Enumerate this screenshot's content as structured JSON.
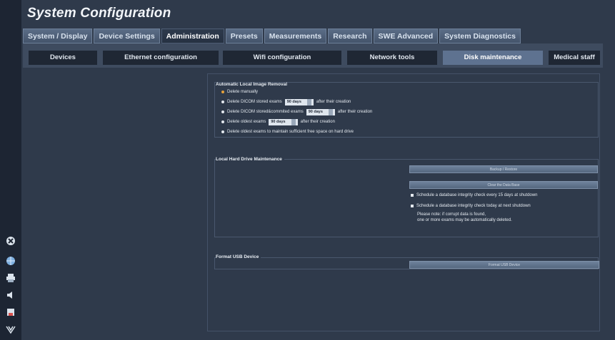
{
  "title": "System Configuration",
  "main_tabs": [
    {
      "label": "System / Display"
    },
    {
      "label": "Device Settings"
    },
    {
      "label": "Administration"
    },
    {
      "label": "Presets"
    },
    {
      "label": "Measurements"
    },
    {
      "label": "Research"
    },
    {
      "label": "SWE Advanced"
    },
    {
      "label": "System Diagnostics"
    }
  ],
  "active_main_tab": "Administration",
  "sub_tabs": [
    {
      "label": "Devices"
    },
    {
      "label": "Ethernet configuration"
    },
    {
      "label": "Wifi configuration"
    },
    {
      "label": "Network tools"
    },
    {
      "label": "Disk maintenance"
    },
    {
      "label": "Medical staff"
    }
  ],
  "active_sub_tab": "Disk maintenance",
  "auto_removal": {
    "title": "Automatic Local Image Removal",
    "opt1": "Delete manually",
    "opt2_pre": "Delete DICOM stored exams",
    "opt2_days": "90 days",
    "opt2_post": "after their creation",
    "opt3_pre": "Delete DICOM stored&commited exams",
    "opt3_days": "90 days",
    "opt3_post": "after their creation",
    "opt4_pre": "Delete oldest exams",
    "opt4_days": "90 days",
    "opt4_post": "after their creation",
    "opt5": "Delete oldest exams to maintain sufficient free space on hard drive",
    "selected": "Delete manually"
  },
  "hdd": {
    "title": "Local Hard Drive Maintenance",
    "backup_btn": "Backup / Restore",
    "clear_btn": "Clear the Data Base",
    "check1": "Schedule a database integrity check every 15 days at shutdown",
    "check2": "Schedule a database integrity check today at next shutdown",
    "note1": "Please note: if corrupt data is found,",
    "note2": "one or more exams may be automatically deleted."
  },
  "usb": {
    "title": "Format USB Device",
    "format_btn": "Format USB Device"
  },
  "colors": {
    "background": "#2f3a4b",
    "active_subtab": "#5e7290",
    "selected_radio": "#e6a23c"
  },
  "rail_icons": [
    "close-icon",
    "globe-icon",
    "printer-icon",
    "volume-icon",
    "record-icon",
    "signal-icon"
  ]
}
